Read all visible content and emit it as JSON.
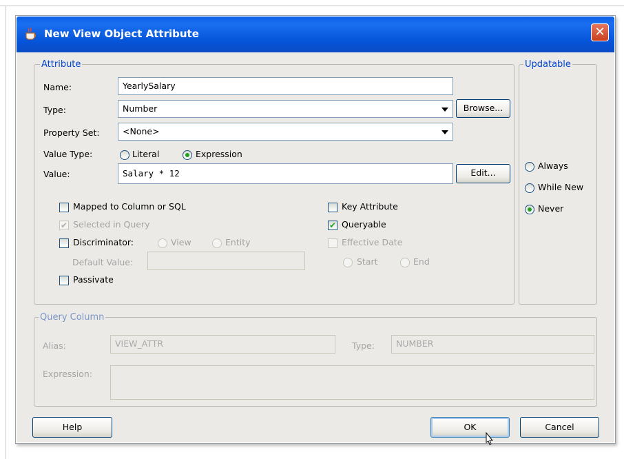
{
  "dialog": {
    "title": "New View Object Attribute",
    "close_glyph": "✕"
  },
  "attribute": {
    "legend": "Attribute",
    "name_label": "Name:",
    "name_value": "YearlySalary",
    "type_label": "Type:",
    "type_value": "Number",
    "browse_label": "Browse...",
    "property_set_label": "Property Set:",
    "property_set_value": "<None>",
    "value_type_label": "Value Type:",
    "value_type_options": [
      "Literal",
      "Expression"
    ],
    "value_type_selected": "Expression",
    "value_label": "Value:",
    "value_value": "Salary * 12",
    "edit_label": "Edit...",
    "checkboxes": {
      "mapped": {
        "label": "Mapped to Column or SQL",
        "checked": false,
        "enabled": true
      },
      "selected_in_query": {
        "label": "Selected in Query",
        "checked": true,
        "enabled": false
      },
      "discriminator": {
        "label": "Discriminator:",
        "checked": false,
        "enabled": true
      },
      "passivate": {
        "label": "Passivate",
        "checked": false,
        "enabled": true
      },
      "key_attribute": {
        "label": "Key Attribute",
        "checked": false,
        "enabled": true
      },
      "queryable": {
        "label": "Queryable",
        "checked": true,
        "enabled": true
      },
      "effective_date": {
        "label": "Effective Date",
        "checked": false,
        "enabled": false
      }
    },
    "discriminator_options": [
      "View",
      "Entity"
    ],
    "default_value_label": "Default Value:",
    "default_value_value": "",
    "effective_date_options": [
      "Start",
      "End"
    ]
  },
  "updatable": {
    "legend": "Updatable",
    "options": [
      "Always",
      "While New",
      "Never"
    ],
    "selected": "Never"
  },
  "query_column": {
    "legend": "Query Column",
    "alias_label": "Alias:",
    "alias_value": "VIEW_ATTR",
    "type_label": "Type:",
    "type_value": "NUMBER",
    "expression_label": "Expression:",
    "expression_value": ""
  },
  "buttons": {
    "help": "Help",
    "ok": "OK",
    "cancel": "Cancel"
  },
  "colors": {
    "title_bar": "#0654d8",
    "legend_text": "#0046d5",
    "check_mark": "#21a121"
  }
}
